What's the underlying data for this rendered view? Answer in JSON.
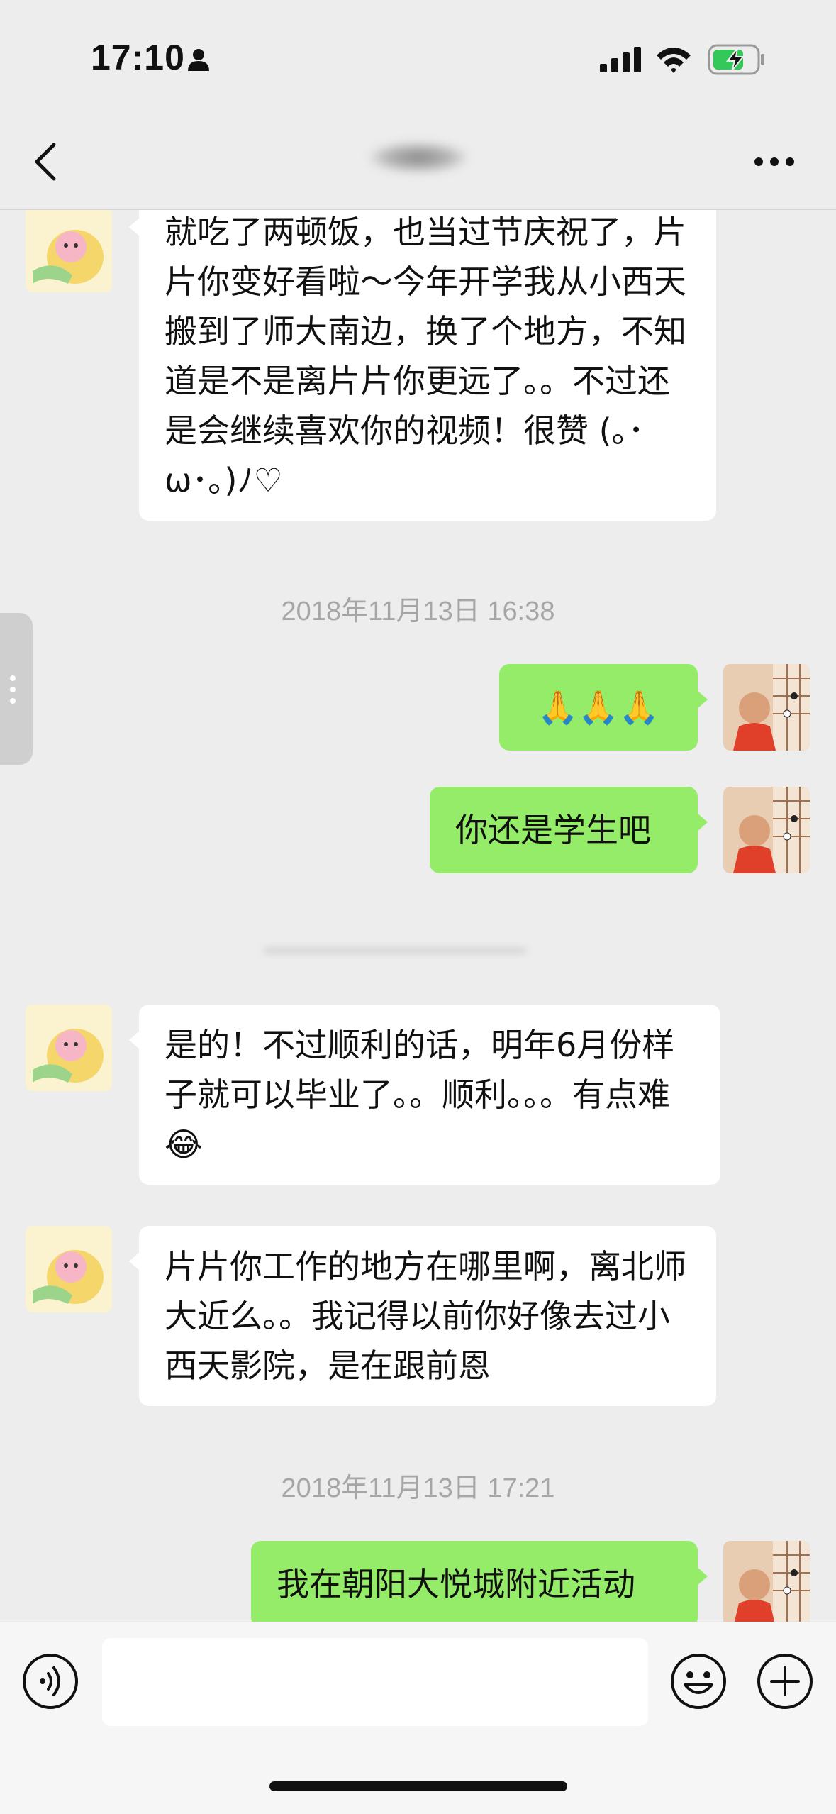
{
  "status_bar": {
    "time": "17:10",
    "icons": [
      "person-icon",
      "signal-icon",
      "wifi-icon",
      "battery-charging-icon"
    ]
  },
  "nav": {
    "back_icon": "chevron-left-icon",
    "more_icon": "more-dots-icon"
  },
  "messages": [
    {
      "side": "in",
      "text": "就吃了两顿饭，也当过节庆祝了，片片你变好看啦～今年开学我从小西天搬到了师大南边，换了个地方，不知道是不是离片片你更远了。。不过还是会继续喜欢你的视频！很赞 (｡･ω･｡)ﾉ♡"
    },
    {
      "side": "out",
      "text": "🙏🙏🙏"
    },
    {
      "side": "out",
      "text": "你还是学生吧"
    },
    {
      "side": "in",
      "text": "是的！不过顺利的话，明年6月份样子就可以毕业了。。顺利。。。有点难😂"
    },
    {
      "side": "in",
      "text": "片片你工作的地方在哪里啊，离北师大近么。。我记得以前你好像去过小西天影院，是在跟前恩"
    },
    {
      "side": "out",
      "text": "我在朝阳大悦城附近活动"
    }
  ],
  "timestamps": [
    "2018年11月13日 16:38",
    "2018年11月13日 17:21"
  ],
  "input_bar": {
    "voice_icon": "voice-icon",
    "emoji_icon": "emoji-icon",
    "plus_icon": "plus-icon"
  },
  "colors": {
    "background": "#ededed",
    "outgoing_bubble": "#95ec69",
    "incoming_bubble": "#ffffff",
    "timestamp": "#a6a6a6"
  }
}
